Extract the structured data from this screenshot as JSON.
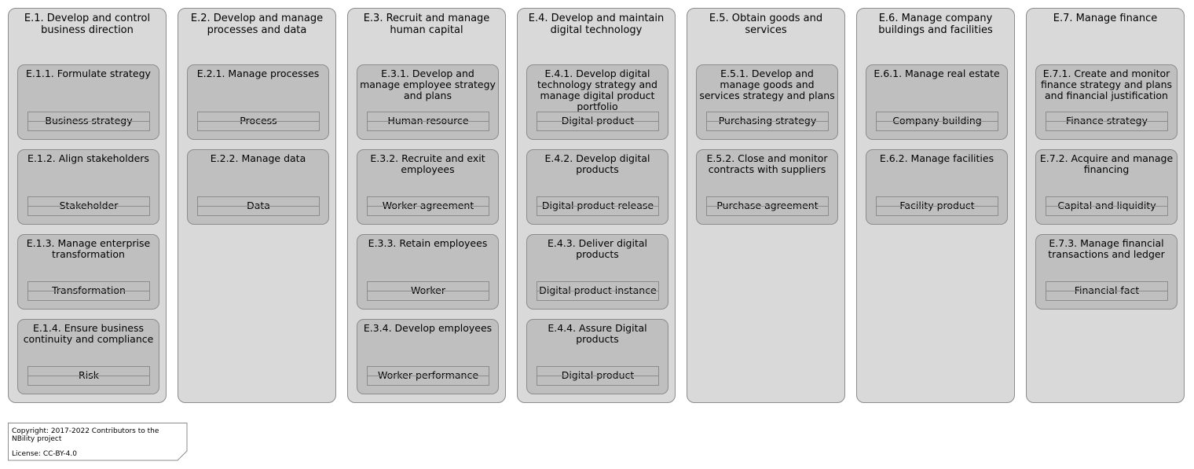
{
  "columns": [
    {
      "title": "E.1. Develop and control business direction",
      "capabilities": [
        {
          "title": "E.1.1. Formulate strategy",
          "entity": "Business strategy"
        },
        {
          "title": "E.1.2. Align stakeholders",
          "entity": "Stakeholder"
        },
        {
          "title": "E.1.3. Manage enterprise transformation",
          "entity": "Transformation"
        },
        {
          "title": "E.1.4. Ensure business continuity and compliance",
          "entity": "Risk"
        }
      ]
    },
    {
      "title": "E.2. Develop and manage processes and data",
      "capabilities": [
        {
          "title": "E.2.1. Manage processes",
          "entity": "Process"
        },
        {
          "title": "E.2.2. Manage data",
          "entity": "Data"
        }
      ]
    },
    {
      "title": "E.3. Recruit and manage human capital",
      "capabilities": [
        {
          "title": "E.3.1. Develop and manage employee strategy and plans",
          "entity": "Human resource"
        },
        {
          "title": "E.3.2. Recruite and exit employees",
          "entity": "Worker agreement"
        },
        {
          "title": "E.3.3. Retain employees",
          "entity": "Worker"
        },
        {
          "title": "E.3.4. Develop employees",
          "entity": "Worker performance"
        }
      ]
    },
    {
      "title": "E.4. Develop and maintain digital technology",
      "capabilities": [
        {
          "title": "E.4.1. Develop digital technology strategy and manage digital product portfolio",
          "entity": "Digital product"
        },
        {
          "title": "E.4.2. Develop digital products",
          "entity": "Digital product release"
        },
        {
          "title": "E.4.3. Deliver digital products",
          "entity": "Digital product instance"
        },
        {
          "title": "E.4.4. Assure Digital products",
          "entity": "Digital product"
        }
      ]
    },
    {
      "title": "E.5. Obtain goods and services",
      "capabilities": [
        {
          "title": "E.5.1. Develop and manage goods and services strategy and plans",
          "entity": "Purchasing strategy"
        },
        {
          "title": "E.5.2. Close and monitor contracts with suppliers",
          "entity": "Purchase agreement"
        }
      ]
    },
    {
      "title": "E.6. Manage company buildings and facilities",
      "capabilities": [
        {
          "title": "E.6.1. Manage real estate",
          "entity": "Company building"
        },
        {
          "title": "E.6.2. Manage facilities",
          "entity": "Facility product"
        }
      ]
    },
    {
      "title": "E.7. Manage finance",
      "capabilities": [
        {
          "title": "E.7.1. Create and monitor finance strategy and plans and financial justification",
          "entity": "Finance strategy"
        },
        {
          "title": "E.7.2. Acquire and manage financing",
          "entity": "Capital and liquidity"
        },
        {
          "title": "E.7.3. Manage financial transactions and ledger",
          "entity": "Financial fact"
        }
      ]
    }
  ],
  "note": {
    "copyright": "Copyright: 2017-2022 Contributors to the NBility project",
    "license": "License: CC-BY-4.0"
  }
}
